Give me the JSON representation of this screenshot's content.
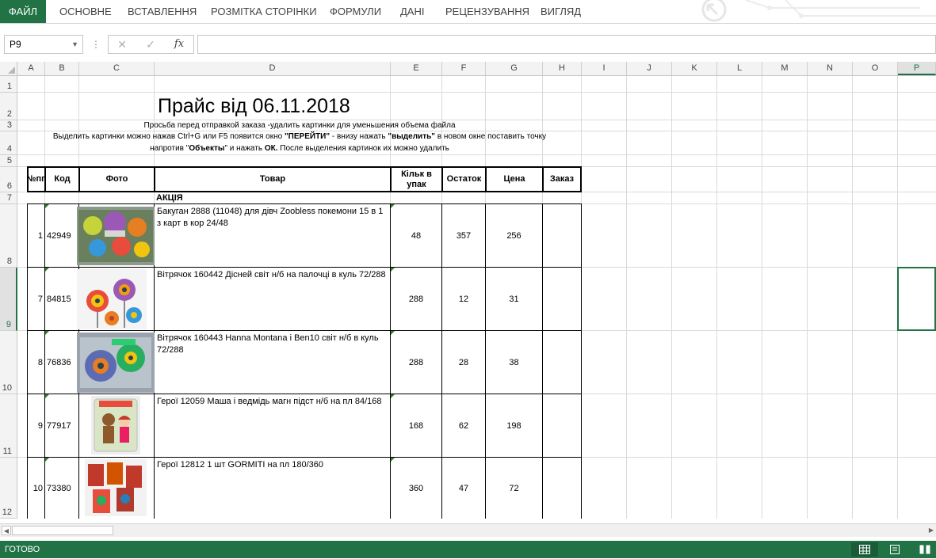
{
  "ribbon": {
    "tabs": [
      "ФАЙЛ",
      "ОСНОВНЕ",
      "ВСТАВЛЕННЯ",
      "РОЗМІТКА СТОРІНКИ",
      "ФОРМУЛИ",
      "ДАНІ",
      "РЕЦЕНЗУВАННЯ",
      "ВИГЛЯД"
    ],
    "active_tab": "ФАЙЛ",
    "accent": "#217346"
  },
  "formula_bar": {
    "name_box": "P9",
    "dots": "⋮",
    "cancel_icon": "✕",
    "enter_icon": "✓",
    "fx_label": "fx",
    "formula": ""
  },
  "columns": [
    "A",
    "B",
    "C",
    "D",
    "E",
    "F",
    "G",
    "H",
    "I",
    "J",
    "K",
    "L",
    "M",
    "N",
    "O",
    "P"
  ],
  "selected_column": "P",
  "rows": [
    "1",
    "2",
    "3",
    "4",
    "5",
    "6",
    "7",
    "8",
    "9",
    "10",
    "11",
    "12"
  ],
  "selected_row": "9",
  "sheet": {
    "title": "Прайс від 06.11.2018",
    "note_row3": "Просьба перед отправкой заказа -удалить картинки для уменьшения объема файла",
    "note_row4_a": "Выделить картинки можно нажав Ctrl+G или F5 появится окно ",
    "note_row4_b": "\"ПЕРЕЙТИ\"",
    "note_row4_c": " - внизу нажать ",
    "note_row4_d": "\"выделить\"",
    "note_row4_e": " в новом окне поставить точку",
    "note_row4_line2_a": "напротив \"",
    "note_row4_line2_b": "Объекты",
    "note_row4_line2_c": "\" и нажать ",
    "note_row4_line2_d": "ОК.",
    "note_row4_line2_e": " После выделения картинок их можно удалить",
    "headers": {
      "num": "№пп",
      "code": "Код",
      "photo": "Фото",
      "product": "Товар",
      "pack": "Кільк в упак",
      "stock": "Остаток",
      "price": "Цена",
      "order": "Заказ"
    },
    "section": "АКЦІЯ",
    "items": [
      {
        "num": "1",
        "code": "42949",
        "name": "Бакуган 2888 (11048) для дівч Zoobless покемони 15 в 1 з карт в кор 24/48",
        "pack": "48",
        "stock": "357",
        "price": "256",
        "order": ""
      },
      {
        "num": "7",
        "code": "84815",
        "name": "Вітрячок 160442 Дісней світ н/б на палочці в куль 72/288",
        "pack": "288",
        "stock": "12",
        "price": "31",
        "order": ""
      },
      {
        "num": "8",
        "code": "76836",
        "name": "Вітрячок 160443 Hanna Montana і Ben10 світ н/б в куль 72/288",
        "pack": "288",
        "stock": "28",
        "price": "38",
        "order": ""
      },
      {
        "num": "9",
        "code": "77917",
        "name": "Герої 12059 Маша і ведмідь магн підст н/б на пл 84/168",
        "pack": "168",
        "stock": "62",
        "price": "198",
        "order": ""
      },
      {
        "num": "10",
        "code": "73380",
        "name": "Герої 12812 1 шт GORMITI на пл 180/360",
        "pack": "360",
        "stock": "47",
        "price": "72",
        "order": ""
      }
    ]
  },
  "status_bar": {
    "text": "ГОТОВО",
    "color": "#217346"
  }
}
